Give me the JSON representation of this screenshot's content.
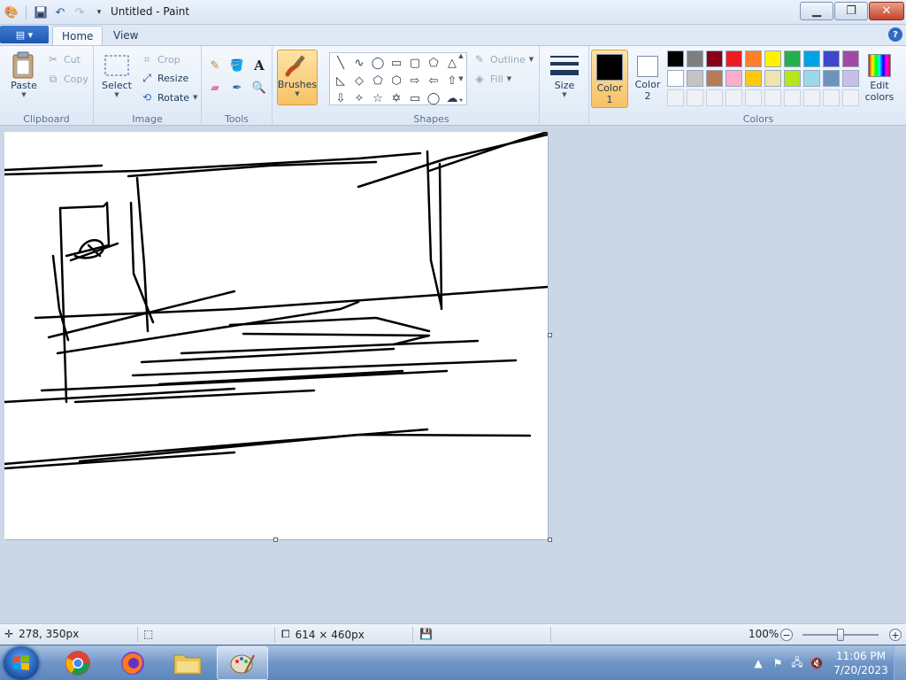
{
  "window": {
    "title": "Untitled - Paint"
  },
  "tabs": {
    "file_icon": "paint-menu-icon",
    "home": "Home",
    "view": "View"
  },
  "ribbon": {
    "clipboard": {
      "label": "Clipboard",
      "paste": "Paste",
      "cut": "Cut",
      "copy": "Copy"
    },
    "image": {
      "label": "Image",
      "select": "Select",
      "crop": "Crop",
      "resize": "Resize",
      "rotate": "Rotate"
    },
    "tools": {
      "label": "Tools",
      "text_tool_glyph": "A"
    },
    "brushes": {
      "label": "Brushes"
    },
    "shapes": {
      "label": "Shapes",
      "outline": "Outline",
      "fill": "Fill"
    },
    "size": {
      "label": "Size"
    },
    "color1": {
      "label_line1": "Color",
      "label_line2": "1",
      "value": "#000000"
    },
    "color2": {
      "label_line1": "Color",
      "label_line2": "2",
      "value": "#ffffff"
    },
    "colors": {
      "label": "Colors",
      "edit_line1": "Edit",
      "edit_line2": "colors"
    },
    "palette_row1": [
      "#000000",
      "#7f7f7f",
      "#880015",
      "#ed1c24",
      "#ff7f27",
      "#fff200",
      "#22b14c",
      "#00a2e8",
      "#3f48cc",
      "#a349a4"
    ],
    "palette_row2": [
      "#ffffff",
      "#c3c3c3",
      "#b97a57",
      "#ffaec9",
      "#ffc90e",
      "#efe4b0",
      "#b5e61d",
      "#99d9ea",
      "#7092be",
      "#c8bfe7"
    ]
  },
  "statusbar": {
    "cursor_pos": "278, 350px",
    "canvas_size": "614 × 460px",
    "zoom": "100%"
  },
  "taskbar": {
    "time": "11:06 PM",
    "date": "7/20/2023"
  }
}
